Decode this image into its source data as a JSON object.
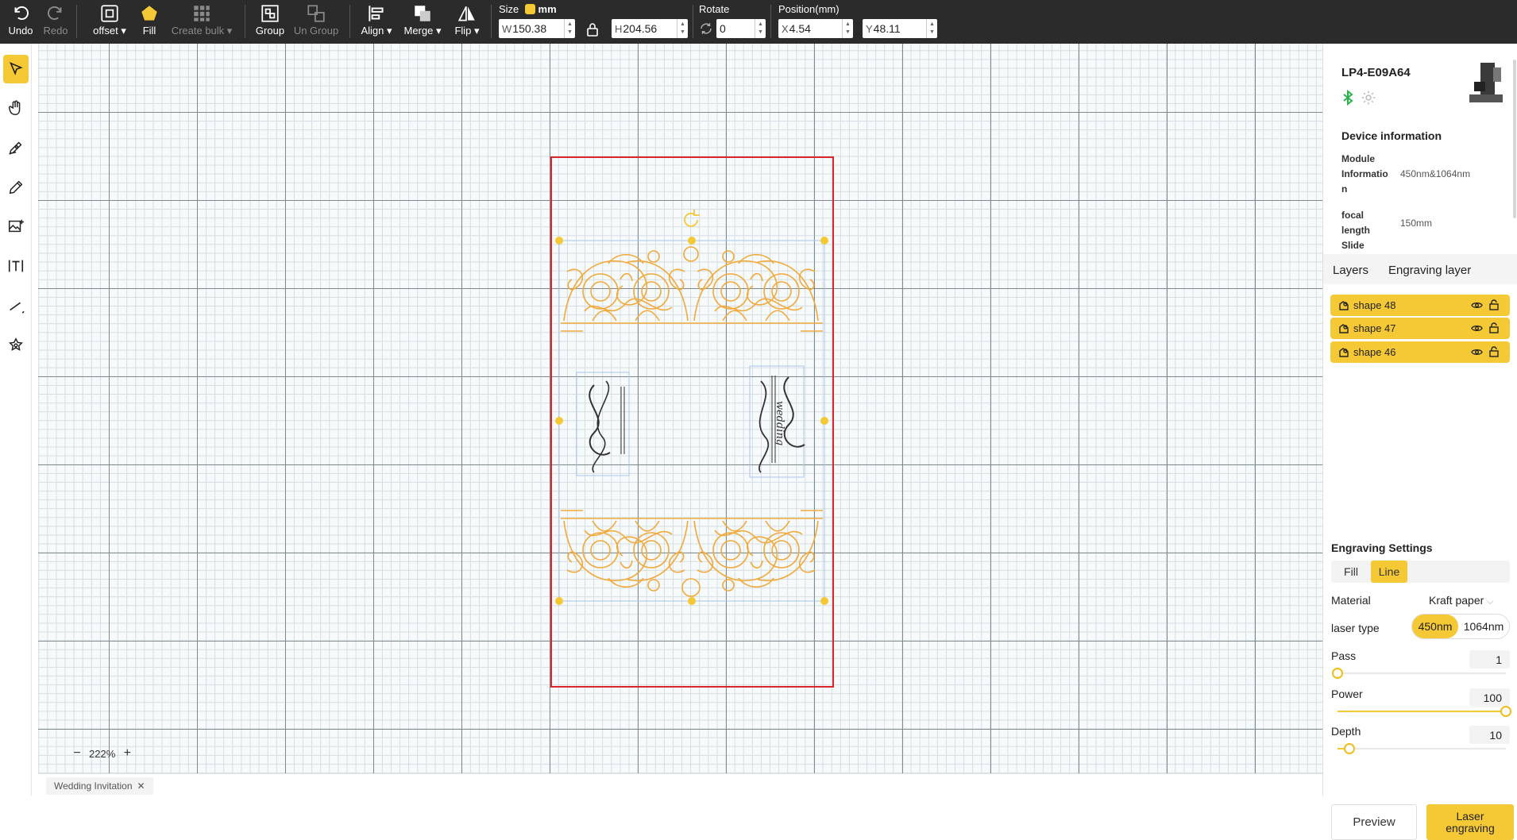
{
  "toolbar": {
    "undo": "Undo",
    "redo": "Redo",
    "offset": "offset",
    "fill": "Fill",
    "create_bulk": "Create bulk",
    "group": "Group",
    "ungroup": "Un Group",
    "align": "Align",
    "merge": "Merge",
    "flip": "Flip",
    "size_label": "Size",
    "unit": "mm",
    "width_prefix": "W",
    "width": "150.38",
    "height_prefix": "H",
    "height": "204.56",
    "rotate_label": "Rotate",
    "rotate": "0",
    "position_label": "Position(mm)",
    "x_prefix": "X",
    "x": "4.54",
    "y_prefix": "Y",
    "y": "48.11"
  },
  "left_tools": [
    "select-icon",
    "hand-icon",
    "pen-icon",
    "pencil-icon",
    "image-icon",
    "text-icon",
    "line-icon",
    "shapes-icon"
  ],
  "canvas": {
    "zoom": "222%",
    "doc_tab": "Wedding Invitation",
    "monograms": [
      "SK",
      "wedding"
    ]
  },
  "device": {
    "name": "LP4-E09A64",
    "info_title": "Device information",
    "module_key_1": "Module",
    "module_key_2": "Informatio",
    "module_key_3": "n",
    "module_value": "450nm&1064nm",
    "focal_key_1": "focal",
    "focal_key_2": "length",
    "focal_value": "150mm",
    "slide_key": "Slide"
  },
  "layers": {
    "tab_layers": "Layers",
    "tab_engraving": "Engraving layer",
    "items": [
      "shape 48",
      "shape 47",
      "shape 46"
    ]
  },
  "engraving": {
    "title": "Engraving Settings",
    "mode_fill": "Fill",
    "mode_line": "Line",
    "material_label": "Material",
    "material_value": "Kraft paper",
    "laser_label": "laser type",
    "laser_450": "450nm",
    "laser_1064": "1064nm",
    "pass_label": "Pass",
    "pass_value": "1",
    "pass_level": 0.0,
    "power_label": "Power",
    "power_value": "100",
    "power_level": 1.0,
    "depth_label": "Depth",
    "depth_value": "10",
    "depth_level": 0.07,
    "preview": "Preview",
    "laser_engraving_1": "Laser",
    "laser_engraving_2": "engraving"
  },
  "colors": {
    "accent": "#f5c836",
    "toolbar_bg": "#2b2b2b",
    "bounds_red": "#d9262c",
    "ornament_orange": "#f2a93b"
  }
}
